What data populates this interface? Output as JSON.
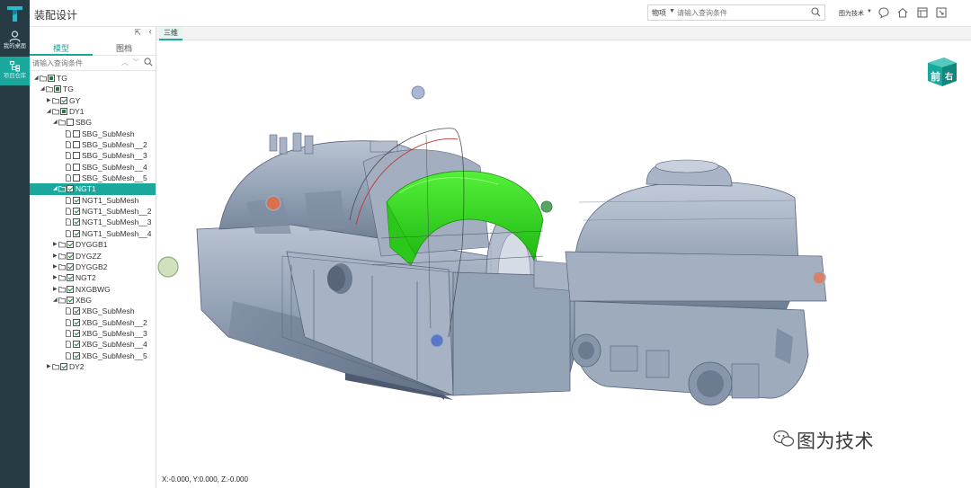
{
  "app": {
    "title": "装配设计"
  },
  "rail": {
    "items": [
      {
        "label": "我的桌面",
        "icon": "user-icon"
      },
      {
        "label": "项目仓库",
        "icon": "repository-icon"
      }
    ]
  },
  "header": {
    "search_scope": "物项",
    "search_placeholder": "请输入查询条件",
    "user_name": "图为技术",
    "icons": [
      "message-icon",
      "home-icon",
      "layout-icon",
      "fullscreen-icon"
    ]
  },
  "panel": {
    "tabs": [
      {
        "label": "模型"
      },
      {
        "label": "图档"
      }
    ],
    "search_placeholder": "请输入查询条件"
  },
  "tree": [
    {
      "label": "TG",
      "depth": 0,
      "toggle": "open",
      "check": "part"
    },
    {
      "label": "TG",
      "depth": 1,
      "toggle": "open",
      "check": "part"
    },
    {
      "label": "GY",
      "depth": 2,
      "toggle": "closed",
      "check": "on"
    },
    {
      "label": "DY1",
      "depth": 2,
      "toggle": "open",
      "check": "part"
    },
    {
      "label": "SBG",
      "depth": 3,
      "toggle": "open",
      "check": "off"
    },
    {
      "label": "SBG_SubMesh",
      "depth": 4,
      "toggle": "",
      "check": "off",
      "leaf": true
    },
    {
      "label": "SBG_SubMesh__2",
      "depth": 4,
      "toggle": "",
      "check": "off",
      "leaf": true
    },
    {
      "label": "SBG_SubMesh__3",
      "depth": 4,
      "toggle": "",
      "check": "off",
      "leaf": true
    },
    {
      "label": "SBG_SubMesh__4",
      "depth": 4,
      "toggle": "",
      "check": "off",
      "leaf": true
    },
    {
      "label": "SBG_SubMesh__5",
      "depth": 4,
      "toggle": "",
      "check": "off",
      "leaf": true
    },
    {
      "label": "NGT1",
      "depth": 3,
      "toggle": "open",
      "check": "on",
      "selected": true
    },
    {
      "label": "NGT1_SubMesh",
      "depth": 4,
      "toggle": "",
      "check": "on",
      "leaf": true
    },
    {
      "label": "NGT1_SubMesh__2",
      "depth": 4,
      "toggle": "",
      "check": "on",
      "leaf": true
    },
    {
      "label": "NGT1_SubMesh__3",
      "depth": 4,
      "toggle": "",
      "check": "on",
      "leaf": true
    },
    {
      "label": "NGT1_SubMesh__4",
      "depth": 4,
      "toggle": "",
      "check": "on",
      "leaf": true
    },
    {
      "label": "DYGGB1",
      "depth": 3,
      "toggle": "closed",
      "check": "on"
    },
    {
      "label": "DYGZZ",
      "depth": 3,
      "toggle": "closed",
      "check": "on"
    },
    {
      "label": "DYGGB2",
      "depth": 3,
      "toggle": "closed",
      "check": "on"
    },
    {
      "label": "NGT2",
      "depth": 3,
      "toggle": "closed",
      "check": "on"
    },
    {
      "label": "NXGBWG",
      "depth": 3,
      "toggle": "closed",
      "check": "on"
    },
    {
      "label": "XBG",
      "depth": 3,
      "toggle": "open",
      "check": "on"
    },
    {
      "label": "XBG_SubMesh",
      "depth": 4,
      "toggle": "",
      "check": "on",
      "leaf": true
    },
    {
      "label": "XBG_SubMesh__2",
      "depth": 4,
      "toggle": "",
      "check": "on",
      "leaf": true
    },
    {
      "label": "XBG_SubMesh__3",
      "depth": 4,
      "toggle": "",
      "check": "on",
      "leaf": true
    },
    {
      "label": "XBG_SubMesh__4",
      "depth": 4,
      "toggle": "",
      "check": "on",
      "leaf": true
    },
    {
      "label": "XBG_SubMesh__5",
      "depth": 4,
      "toggle": "",
      "check": "on",
      "leaf": true
    },
    {
      "label": "DY2",
      "depth": 2,
      "toggle": "closed",
      "check": "on"
    }
  ],
  "view": {
    "tab_label": "三维",
    "coords": "X:-0.000, Y:0.000, Z:-0.000",
    "viewcube": {
      "front": "前",
      "right": "右"
    },
    "watermark": "图为技术",
    "colors": {
      "accent": "#1aa79c",
      "rail": "#263b44",
      "model": "#9aa8ba",
      "highlight": "#33dd22"
    }
  }
}
